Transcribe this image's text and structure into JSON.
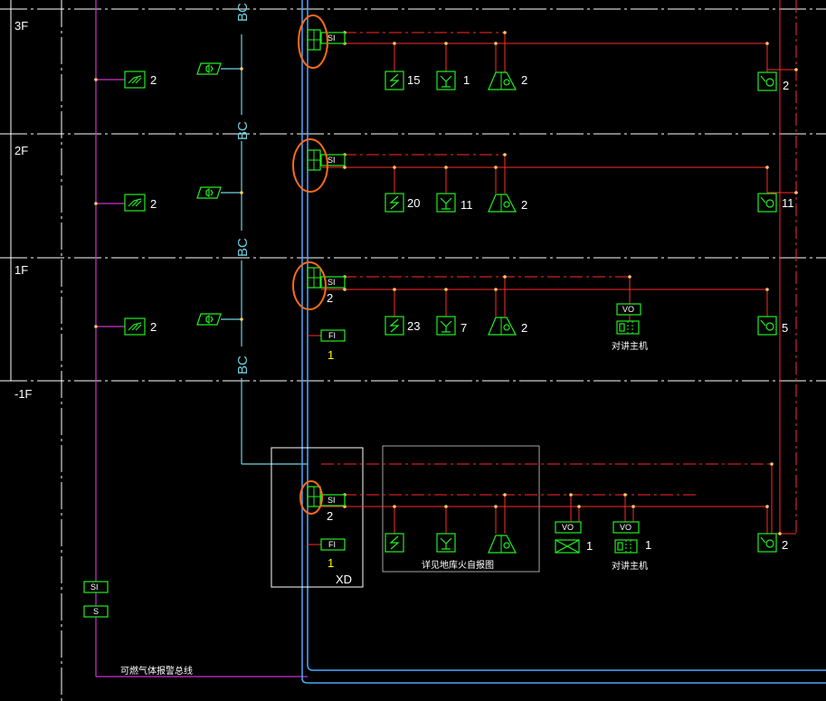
{
  "floors": [
    "3F",
    "2F",
    "1F",
    "-1F"
  ],
  "trunk_label": "BC",
  "tags": {
    "si": "SI",
    "fi": "FI",
    "s": "S",
    "vo": "VO"
  },
  "counts": {
    "gas_detector": [
      "2",
      "2",
      "2"
    ],
    "f3": {
      "smoke": "15",
      "heat": "1",
      "alarm": "2",
      "module": "2"
    },
    "f2": {
      "smoke": "20",
      "heat": "11",
      "alarm": "2",
      "module": "11"
    },
    "f1": {
      "si_count": "2",
      "smoke": "23",
      "heat": "7",
      "alarm": "2",
      "module": "5",
      "fi_count": "1"
    },
    "b1": {
      "si_count": "2",
      "fi_count": "1",
      "damper": "1",
      "intercom": "1",
      "module": "2"
    }
  },
  "notes": {
    "intercom_host": "对讲主机",
    "garage_note": "详见地库火自报图",
    "gas_bus": "可燃气体报警总线",
    "xd": "XD"
  },
  "colors": {
    "background": "#000000",
    "device": "#22ee22",
    "signal_line": "#ff2a2a",
    "bus_line": "#4aa8ff",
    "gas_line": "#cc33cc",
    "bc_line": "#6fd3e3",
    "highlight": "#ff6a1a"
  }
}
